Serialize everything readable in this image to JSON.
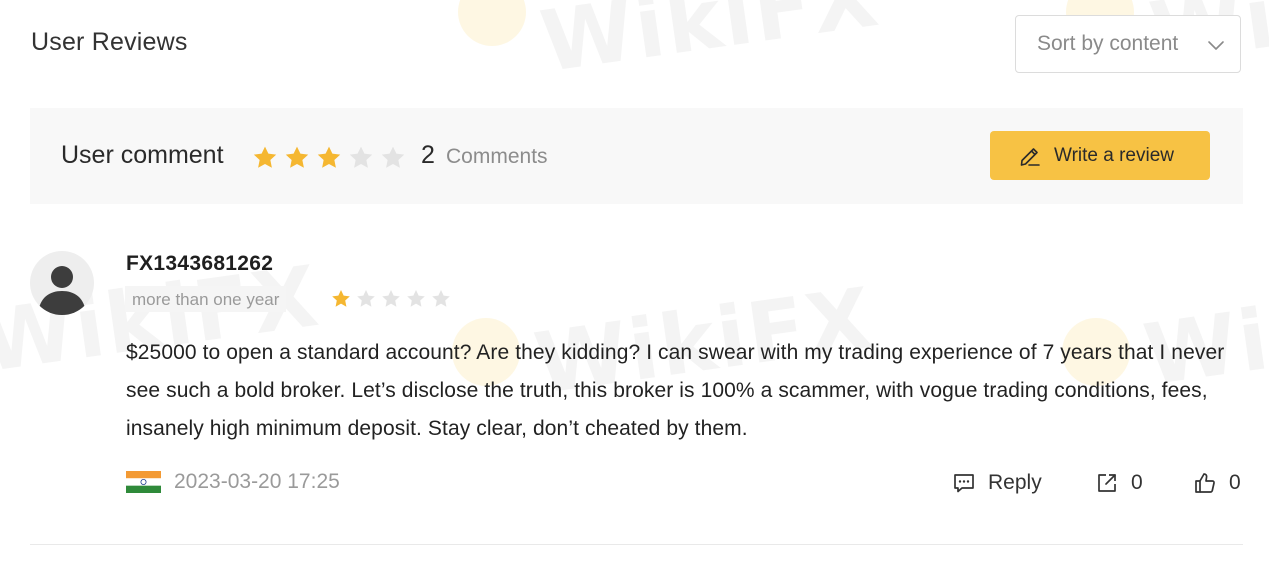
{
  "header": {
    "title": "User Reviews",
    "sort": {
      "selected": "Sort by content",
      "icon": "chevron-down-icon"
    }
  },
  "summary": {
    "title": "User comment",
    "rating": 3,
    "max_rating": 5,
    "comment_count": "2",
    "comment_label": "Comments",
    "write_button": {
      "label": "Write a review",
      "icon": "pencil-icon"
    }
  },
  "review": {
    "username": "FX1343681262",
    "time_tag": "more than one year",
    "rating": 1,
    "max_rating": 5,
    "text": "$25000 to open a standard account? Are they kidding? I can swear with my trading experience of 7 years that I never see such a bold broker. Let’s disclose the truth, this broker is 100% a scammer, with vogue trading conditions, fees, insanely high minimum deposit. Stay clear, don’t cheated by them.",
    "country_flag": "india-flag-icon",
    "date": "2023-03-20 17:25",
    "actions": {
      "reply_label": "Reply",
      "share_count": "0",
      "like_count": "0"
    }
  },
  "colors": {
    "accent": "#f7c244",
    "star_filled": "#f5b731",
    "star_empty": "#e3e3e3",
    "summary_bg": "#f8f8f8"
  }
}
